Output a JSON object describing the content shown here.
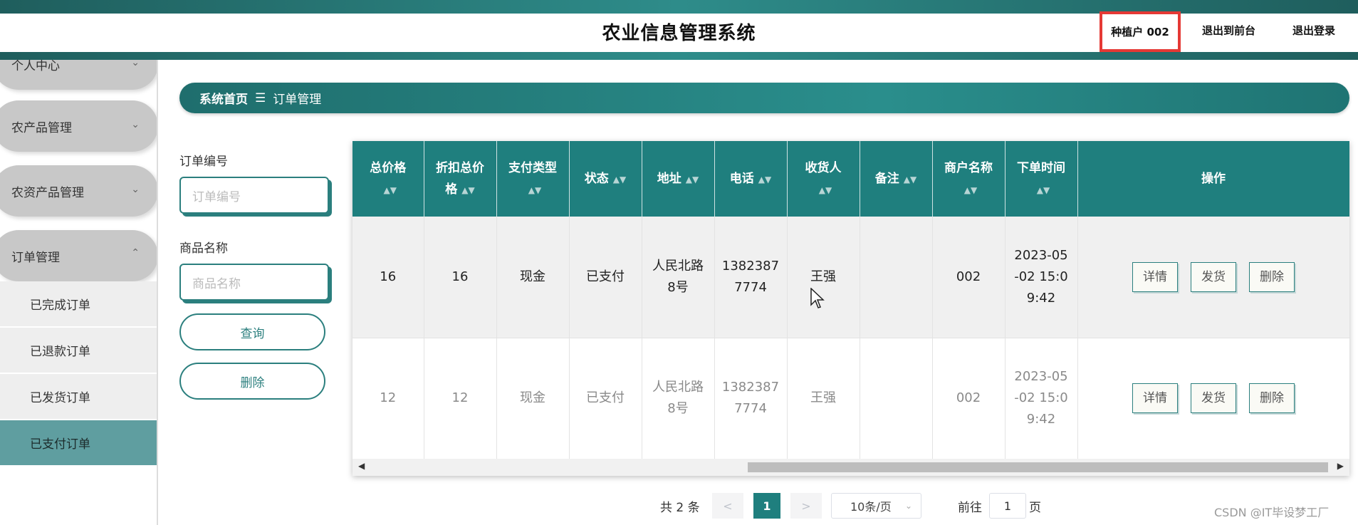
{
  "header": {
    "title": "农业信息管理系统",
    "user_label": "种植户 002",
    "front_link": "退出到前台",
    "logout_link": "退出登录"
  },
  "sidebar": {
    "items": [
      {
        "label": "个人中心"
      },
      {
        "label": "农产品管理"
      },
      {
        "label": "农资产品管理"
      },
      {
        "label": "订单管理"
      }
    ],
    "subitems": [
      {
        "label": "已完成订单"
      },
      {
        "label": "已退款订单"
      },
      {
        "label": "已发货订单"
      },
      {
        "label": "已支付订单",
        "active": true
      }
    ]
  },
  "breadcrumb": {
    "home": "系统首页",
    "separator": "☰",
    "current": "订单管理"
  },
  "search": {
    "order_no_label": "订单编号",
    "order_no_placeholder": "订单编号",
    "product_label": "商品名称",
    "product_placeholder": "商品名称",
    "query_button": "查询",
    "delete_button": "删除"
  },
  "table": {
    "columns": [
      "总价格",
      "折扣总价格",
      "支付类型",
      "状态",
      "地址",
      "电话",
      "收货人",
      "备注",
      "商户名称",
      "下单时间",
      "操作"
    ],
    "column_lines": [
      [
        "总价格"
      ],
      [
        "折扣总价",
        "格"
      ],
      [
        "支付类型"
      ],
      [
        "状态"
      ],
      [
        "地址"
      ],
      [
        "电话"
      ],
      [
        "收货人"
      ],
      [
        "备注"
      ],
      [
        "商户名称"
      ],
      [
        "下单时间"
      ],
      [
        "操作"
      ]
    ],
    "rows": [
      {
        "total": "16",
        "discount_total": "16",
        "pay_type": "现金",
        "status": "已支付",
        "address": [
          "人民北路",
          "8号"
        ],
        "phone": [
          "1382387",
          "7774"
        ],
        "receiver": "王强",
        "note": "",
        "merchant": "002",
        "order_time": [
          "2023-05",
          "-02 15:0",
          "9:42"
        ]
      },
      {
        "total": "12",
        "discount_total": "12",
        "pay_type": "现金",
        "status": "已支付",
        "address": [
          "人民北路",
          "8号"
        ],
        "phone": [
          "1382387",
          "7774"
        ],
        "receiver": "王强",
        "note": "",
        "merchant": "002",
        "order_time": [
          "2023-05",
          "-02 15:0",
          "9:42"
        ]
      }
    ],
    "ops": {
      "detail": "详情",
      "ship": "发货",
      "delete": "删除"
    }
  },
  "pagination": {
    "total_text": "共 2 条",
    "prev": "<",
    "current_page": "1",
    "next": ">",
    "page_size": "10条/页",
    "goto_label": "前往",
    "goto_value": "1",
    "page_unit": "页"
  },
  "watermark": "CSDN @IT毕设梦工厂",
  "colors": {
    "accent": "#1f7f7e",
    "highlight": "#e53935",
    "sidebar_pill": "#c8c8c8"
  }
}
